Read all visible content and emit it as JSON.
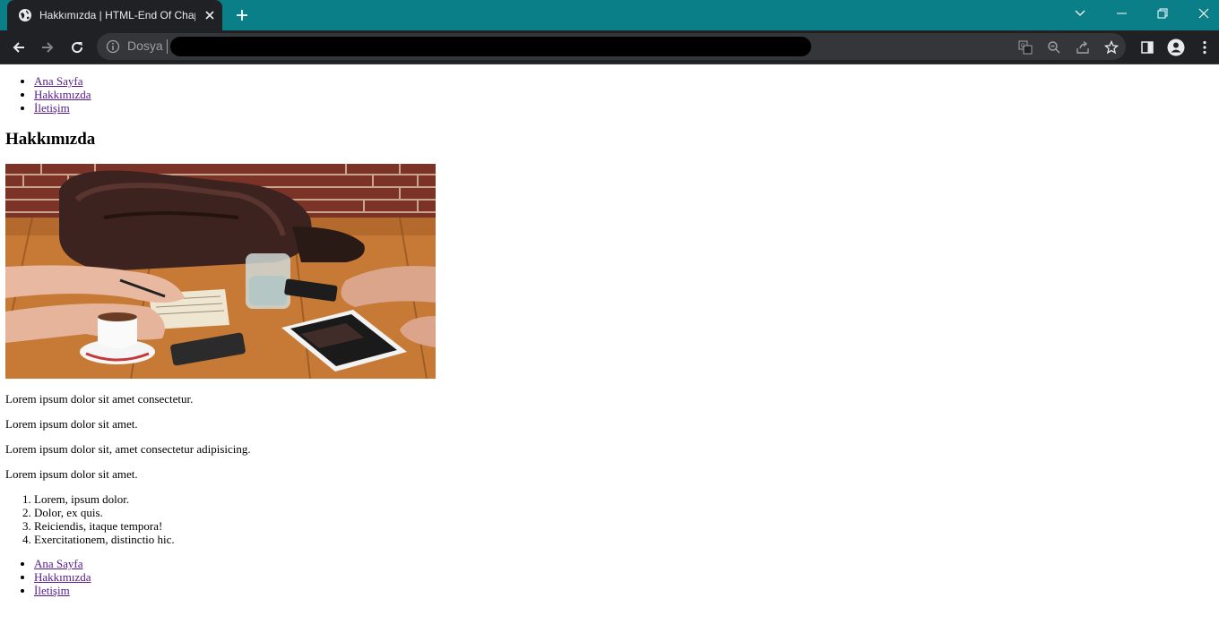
{
  "browser": {
    "tab_title": "Hakkımızda | HTML-End Of Chap",
    "address_scheme": "Dosya",
    "accent_color": "#0b7f87"
  },
  "nav_top": [
    {
      "label": "Ana Sayfa"
    },
    {
      "label": "Hakkımızda"
    },
    {
      "label": "İletişim"
    }
  ],
  "heading": "Hakkımızda",
  "paragraphs": [
    "Lorem ipsum dolor sit amet consectetur.",
    "Lorem ipsum dolor sit amet.",
    "Lorem ipsum dolor sit, amet consectetur adipisicing.",
    "Lorem ipsum dolor sit amet."
  ],
  "ordered_list": [
    "Lorem, ipsum dolor.",
    "Dolor, ex quis.",
    "Reiciendis, itaque tempora!",
    "Exercitationem, distinctio hic."
  ],
  "nav_bottom": [
    {
      "label": "Ana Sayfa"
    },
    {
      "label": "Hakkımızda"
    },
    {
      "label": "İletişim"
    }
  ]
}
